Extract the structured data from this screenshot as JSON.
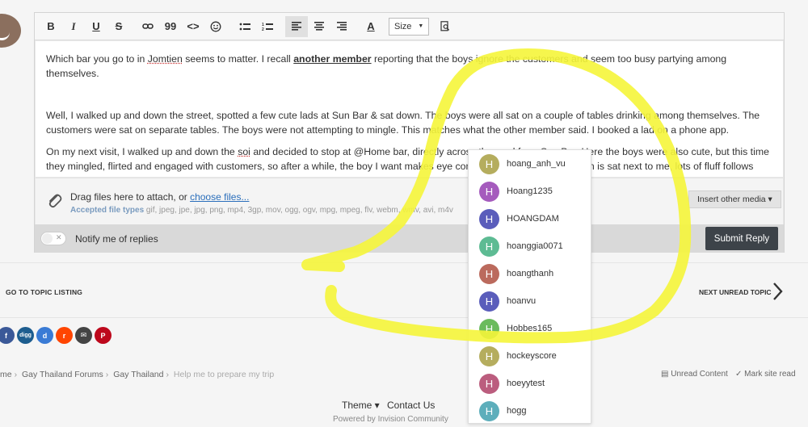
{
  "editor": {
    "toolbar": {
      "bold": "B",
      "italic": "I",
      "underline": "U",
      "strike": "S",
      "quote": "99",
      "code": "<>",
      "text_color": "A",
      "size_label": "Size"
    },
    "content": {
      "p1_a": "Which bar you go to in ",
      "p1_link": "Jomtien",
      "p1_b": " seems to matter.     I recall ",
      "p1_mention": "another member",
      "p1_c": " reporting that the boys ignore the customers and seem too busy partying among themselves.",
      "p2": "Well, I walked up and down the street, spotted a few cute lads at Sun Bar & sat down.  The boys were all sat on a couple of tables drinking among themselves.   The customers were sat on separate tables.    The boys were not attempting to mingle.   This matches what the other member said.  I booked a lad on a phone app.",
      "p3_a": "On my next visit, I walked up and down the ",
      "p3_link": "soi",
      "p3_b": " and decided to stop at @Home bar, directly across the road from Sun Bar.   Here the boys were also cute, but this time they mingled, flirted and engaged with customers, so after a while, the boy I want makes eye contact, we chat and he is soon is sat next to me, lots of fluff follows"
    },
    "attach": {
      "drag_text": "Drag files here to attach, or ",
      "choose_link": "choose files...",
      "accepted_label": "Accepted file types",
      "accepted_types": " gif, jpeg, jpe, jpg, png, mp4, 3gp, mov, ogg, ogv, mpg, mpeg, flv, webm, wmv, avi, m4v",
      "insert_media": "Insert other media ▾"
    },
    "notify_label": "Notify me of replies",
    "submit_label": "Submit Reply"
  },
  "navigation": {
    "go_to_topic": "GO TO TOPIC LISTING",
    "next_unread": "NEXT UNREAD TOPIC"
  },
  "share": [
    {
      "label": "f",
      "color": "#3b5998"
    },
    {
      "label": "digg",
      "color": "#1d5d8f"
    },
    {
      "label": "d",
      "color": "#3a7bd5"
    },
    {
      "label": "r",
      "color": "#ff4500"
    },
    {
      "label": "✉",
      "color": "#444444"
    },
    {
      "label": "P",
      "color": "#bd081c"
    }
  ],
  "breadcrumb": {
    "items": [
      "me",
      "Gay Thailand Forums",
      "Gay Thailand",
      "Help me to prepare my trip"
    ],
    "unread": "Unread Content",
    "mark_read": "Mark site read"
  },
  "footer": {
    "theme": "Theme ▾",
    "contact": "Contact Us",
    "powered": "Powered by Invision Community"
  },
  "mentions": [
    {
      "initial": "H",
      "name": "hoang_anh_vu",
      "color": "#b5ad5e"
    },
    {
      "initial": "H",
      "name": "Hoang1235",
      "color": "#a55bbd"
    },
    {
      "initial": "H",
      "name": "HOANGDAM",
      "color": "#5a5dbb"
    },
    {
      "initial": "H",
      "name": "hoanggia0071",
      "color": "#5dbb93"
    },
    {
      "initial": "H",
      "name": "hoangthanh",
      "color": "#bb6a5d"
    },
    {
      "initial": "H",
      "name": "hoanvu",
      "color": "#5a5dbb"
    },
    {
      "initial": "H",
      "name": "Hobbes165",
      "color": "#6bbb5d"
    },
    {
      "initial": "H",
      "name": "hockeyscore",
      "color": "#b5ad5e"
    },
    {
      "initial": "H",
      "name": "hoeyytest",
      "color": "#bb5d7e"
    },
    {
      "initial": "H",
      "name": "hogg",
      "color": "#5daebb"
    }
  ]
}
